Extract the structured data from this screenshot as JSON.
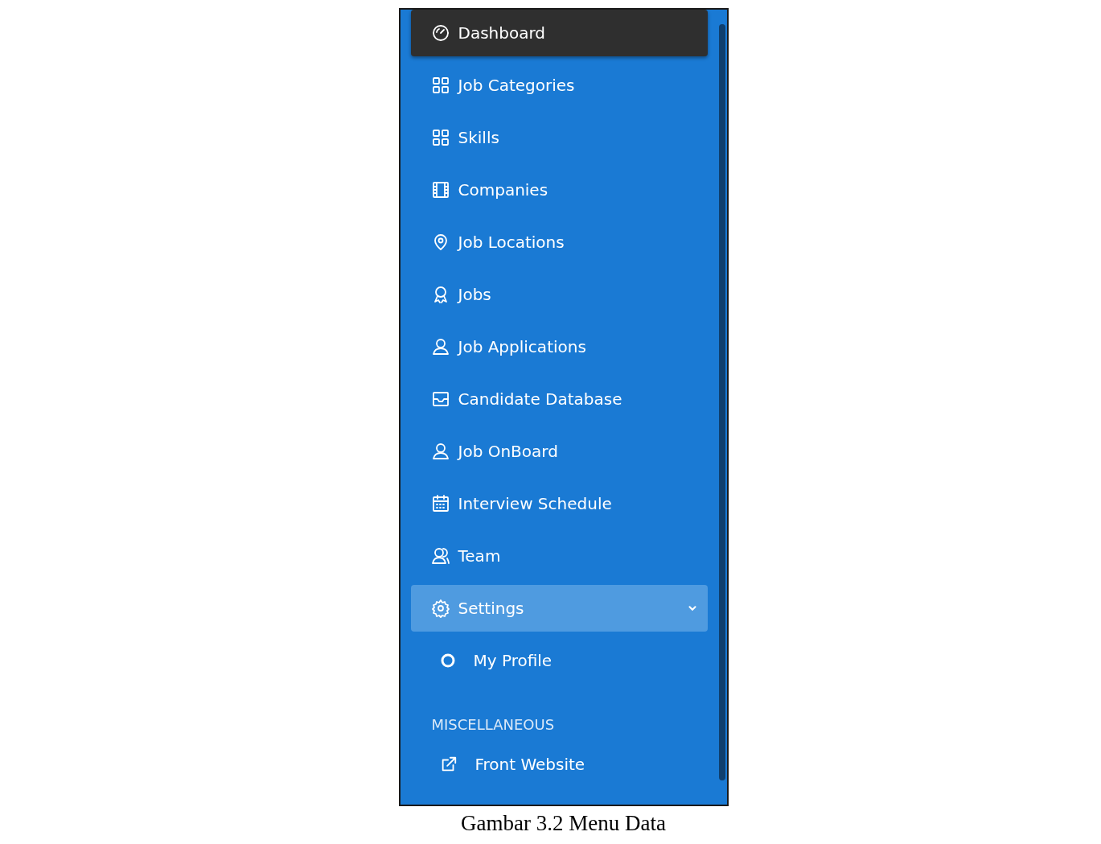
{
  "sidebar": {
    "items": [
      {
        "label": "Dashboard",
        "selected": true
      },
      {
        "label": "Job Categories",
        "selected": false
      },
      {
        "label": "Skills",
        "selected": false
      },
      {
        "label": "Companies",
        "selected": false
      },
      {
        "label": "Job Locations",
        "selected": false
      },
      {
        "label": "Jobs",
        "selected": false
      },
      {
        "label": "Job Applications",
        "selected": false
      },
      {
        "label": "Candidate Database",
        "selected": false
      },
      {
        "label": "Job OnBoard",
        "selected": false
      },
      {
        "label": "Interview Schedule",
        "selected": false
      },
      {
        "label": "Team",
        "selected": false
      },
      {
        "label": "Settings",
        "selected": false,
        "expanded": true,
        "children": [
          {
            "label": "My Profile",
            "selected": false
          }
        ]
      }
    ],
    "sections": [
      {
        "heading": "MISCELLANEOUS",
        "items": [
          {
            "label": "Front Website"
          }
        ]
      }
    ]
  },
  "caption": "Gambar 3.2 Menu Data"
}
